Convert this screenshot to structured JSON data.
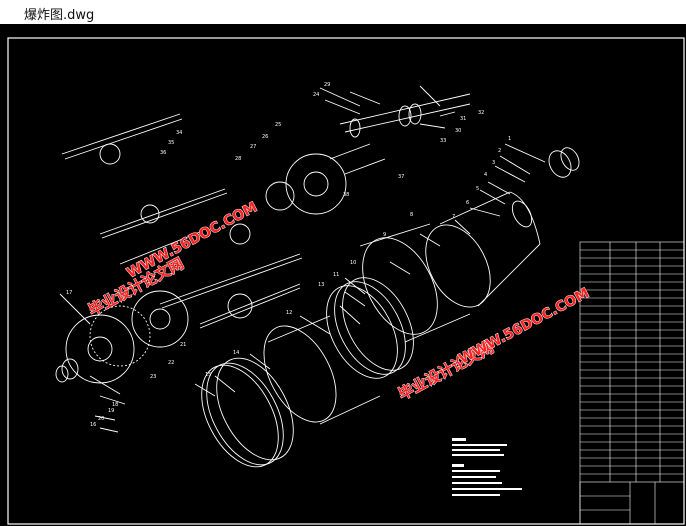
{
  "window": {
    "title": "爆炸图.dwg"
  },
  "watermarks": [
    {
      "text": "毕业设计论文网"
    },
    {
      "text": "WWW.56DOC.COM"
    },
    {
      "text": "毕业设计论文网"
    },
    {
      "text": "WWW.56DOC.COM"
    }
  ],
  "part_labels": [
    "1",
    "2",
    "3",
    "4",
    "5",
    "6",
    "7",
    "8",
    "9",
    "10",
    "11",
    "12",
    "13",
    "14",
    "15",
    "16",
    "17",
    "18",
    "19",
    "20",
    "21",
    "22",
    "23",
    "24",
    "25",
    "26",
    "27",
    "28",
    "29",
    "30",
    "31",
    "32",
    "33",
    "34",
    "35",
    "36",
    "37",
    "38"
  ],
  "colors": {
    "canvas": "#000000",
    "lines": "#ffffff",
    "watermark": "#ff2222"
  }
}
